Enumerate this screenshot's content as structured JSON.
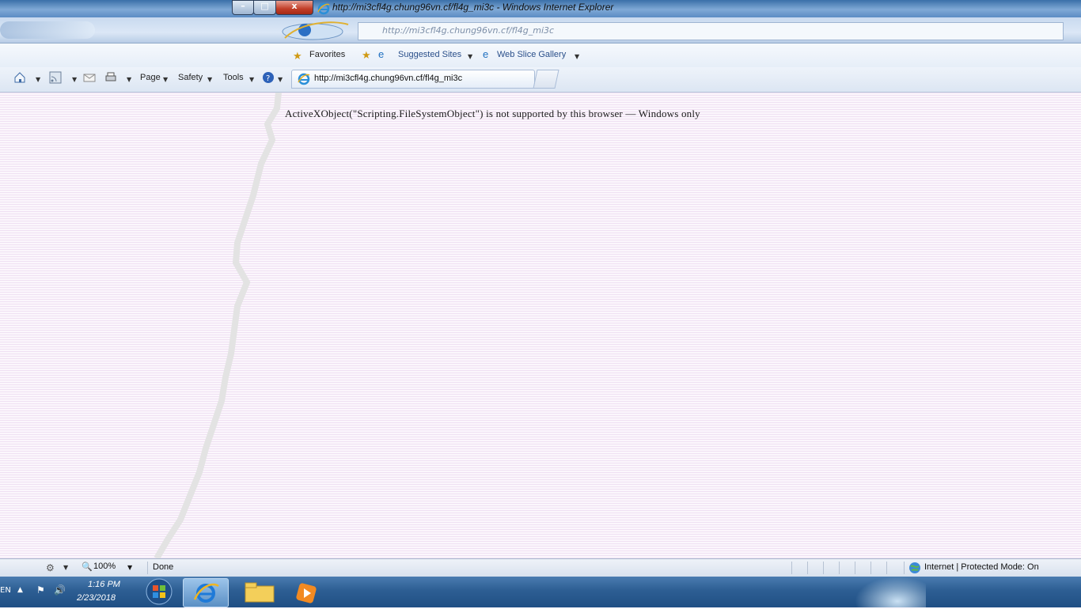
{
  "window": {
    "title": "http://mi3cfl4g.chung96vn.cf/fl4g_mi3c - Windows Internet Explorer",
    "minimize_label": "–",
    "maximize_label": "□",
    "close_label": "x"
  },
  "address_bar": {
    "url": "http://mi3cfl4g.chung96vn.cf/fl4g_mi3c"
  },
  "favorites_bar": {
    "favorites_label": "Favorites",
    "suggested_sites_label": "Suggested Sites",
    "web_slice_gallery_label": "Web Slice Gallery"
  },
  "command_bar": {
    "tab_title": "http://mi3cfl4g.chung96vn.cf/fl4g_mi3c",
    "page_label": "Page",
    "safety_label": "Safety",
    "tools_label": "Tools"
  },
  "page": {
    "text": "ActiveXObject(\"Scripting.FileSystemObject\") is not supported by this browser — Windows only"
  },
  "status_bar": {
    "status_text": "Done",
    "zone_text": "Internet | Protected Mode: On",
    "zoom_level": "100%"
  },
  "taskbar": {
    "language": "EN",
    "clock_time": "1:16 PM",
    "clock_date": "2/23/2018"
  },
  "icons": {
    "home": "home-icon",
    "feeds": "feeds-icon",
    "mail": "mail-icon",
    "print": "print-icon",
    "help": "help-icon"
  }
}
